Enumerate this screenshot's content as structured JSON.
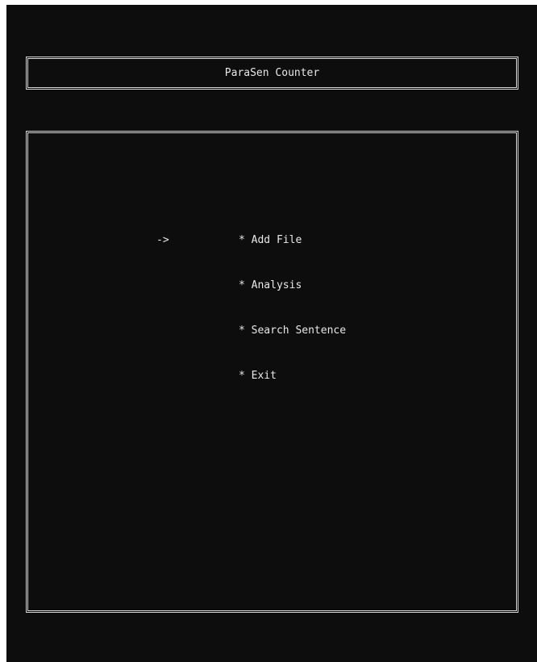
{
  "app": {
    "title": "ParaSen Counter"
  },
  "menu": {
    "cursor": "->",
    "selected_index": 0,
    "items": [
      {
        "label": "* Add File"
      },
      {
        "label": "* Analysis"
      },
      {
        "label": "* Search Sentence"
      },
      {
        "label": "* Exit"
      }
    ]
  },
  "colors": {
    "background": "#0d0d0d",
    "text": "#e8e8e8",
    "border": "#d6d6d6"
  }
}
